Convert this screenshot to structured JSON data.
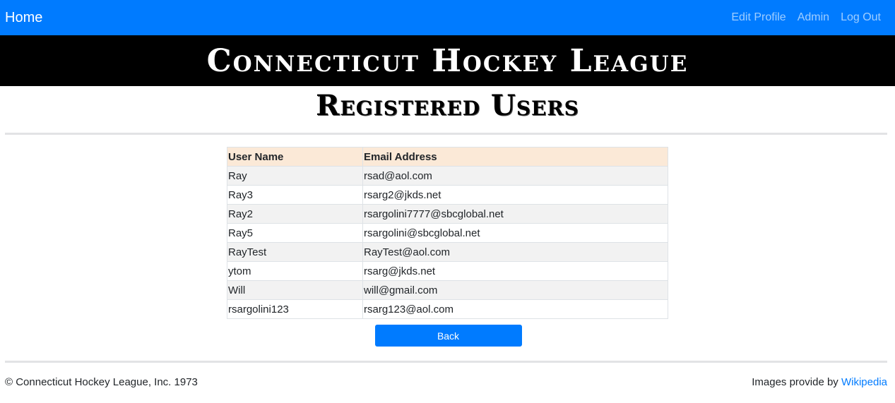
{
  "navbar": {
    "brand": "Home",
    "links": [
      "Edit Profile",
      "Admin",
      "Log Out"
    ]
  },
  "banner": {
    "title": "Connecticut Hockey League"
  },
  "page": {
    "title": "Registered Users"
  },
  "table": {
    "headers": [
      "User Name",
      "Email Address"
    ],
    "rows": [
      [
        "Ray",
        "rsad@aol.com"
      ],
      [
        "Ray3",
        "rsarg2@jkds.net"
      ],
      [
        "Ray2",
        "rsargolini7777@sbcglobal.net"
      ],
      [
        "Ray5",
        "rsargolini@sbcglobal.net"
      ],
      [
        "RayTest",
        "RayTest@aol.com"
      ],
      [
        "ytom",
        "rsarg@jkds.net"
      ],
      [
        "Will",
        "will@gmail.com"
      ],
      [
        "rsargolini123",
        "rsarg123@aol.com"
      ]
    ]
  },
  "back_button": "Back",
  "footer": {
    "copyright": "© Connecticut Hockey League, Inc. 1973",
    "credit_prefix": "Images provide by ",
    "credit_link": "Wikipedia"
  },
  "colors": {
    "navbar": "#007bff",
    "banner": "#000000",
    "header_row": "#fbe9d7",
    "striped_row": "#f2f2f2"
  }
}
